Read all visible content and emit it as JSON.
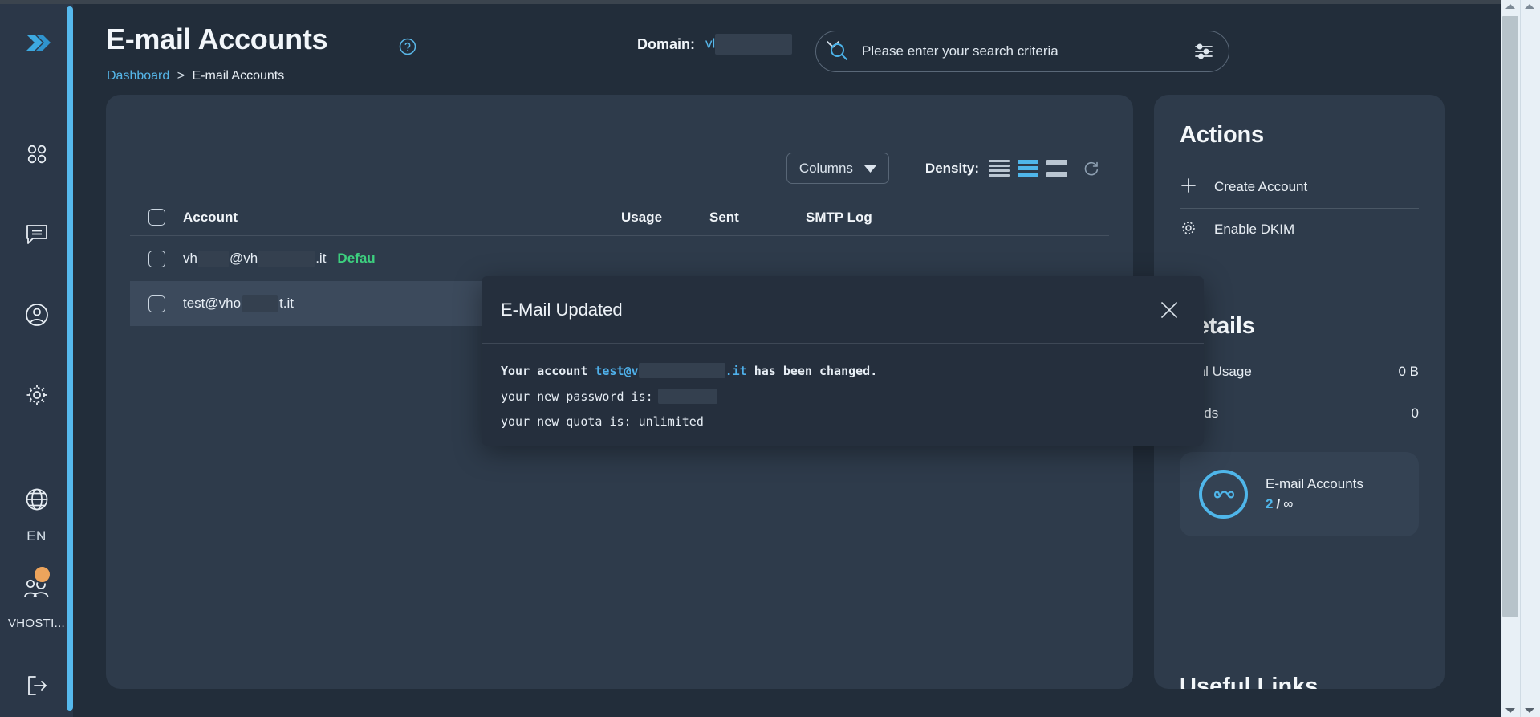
{
  "app": {
    "logo": "double-chevron-logo",
    "accent_color": "#56b9ed",
    "bg_color": "#222d3a",
    "card_color": "#2e3b4b"
  },
  "rail": {
    "items": [
      {
        "name": "dashboard",
        "icon": "grid-icon"
      },
      {
        "name": "messages",
        "icon": "chat-icon"
      },
      {
        "name": "profile",
        "icon": "user-circle-icon"
      },
      {
        "name": "settings",
        "icon": "gear-icon"
      }
    ],
    "language": {
      "icon": "globe-icon",
      "label": "EN"
    },
    "user": {
      "icon": "users-icon",
      "label": "VHOSTI...",
      "badge_color": "#eda45c"
    },
    "logout": {
      "icon": "logout-icon"
    }
  },
  "header": {
    "title": "E-mail Accounts",
    "help_icon": "question-circle-icon",
    "breadcrumb": {
      "link": "Dashboard",
      "separator": ">",
      "current": "E-mail Accounts"
    },
    "domain": {
      "label": "Domain:",
      "value": "vl",
      "redacted": true,
      "caret_icon": "chevron-down-icon"
    },
    "search": {
      "icon": "search-icon",
      "placeholder": "Please enter your search criteria",
      "value": "",
      "filter_icon": "sliders-icon"
    }
  },
  "table": {
    "toolbar": {
      "columns_label": "Columns",
      "columns_caret": "caret-down-icon",
      "density_label": "Density:",
      "density_options": [
        "compact",
        "standard",
        "comfortable"
      ],
      "density_selected": "standard",
      "refresh_icon": "refresh-icon"
    },
    "columns": [
      "Account",
      "Usage",
      "Sent",
      "SMTP Log"
    ],
    "rows": [
      {
        "account_prefix": "vh",
        "account_mid": "@vh",
        "account_suffix": ".it",
        "badge": "Defau",
        "usage": "",
        "sent": "",
        "smtp": "",
        "selected": false
      },
      {
        "account_prefix": "test@vho",
        "account_mid": "",
        "account_suffix": "t.it",
        "badge": "",
        "usage": "",
        "sent": "",
        "smtp": "",
        "selected": true
      }
    ]
  },
  "modal": {
    "title": "E-Mail Updated",
    "close_icon": "close-icon",
    "line1_a": "Your account ",
    "line1_mail": "test@v",
    "line1_tld": ".it",
    "line1_b": " has been changed.",
    "line2": "your new password is:",
    "line3": "your new quota is: unlimited"
  },
  "sidebar": {
    "actions": {
      "heading": "Actions",
      "items": [
        {
          "label": "Create Account",
          "icon": "plus-icon"
        },
        {
          "label": "Enable DKIM",
          "icon": "gear-icon"
        }
      ]
    },
    "details": {
      "heading": "Details",
      "rows": [
        {
          "label": "Total Usage",
          "value": "0 B"
        },
        {
          "label": "Sends",
          "value": "0"
        }
      ],
      "stat": {
        "icon": "infinity-icon",
        "title": "E-mail Accounts",
        "count": "2",
        "separator": "/",
        "limit": "∞"
      }
    },
    "useful_links": {
      "heading": "Useful Links"
    }
  }
}
